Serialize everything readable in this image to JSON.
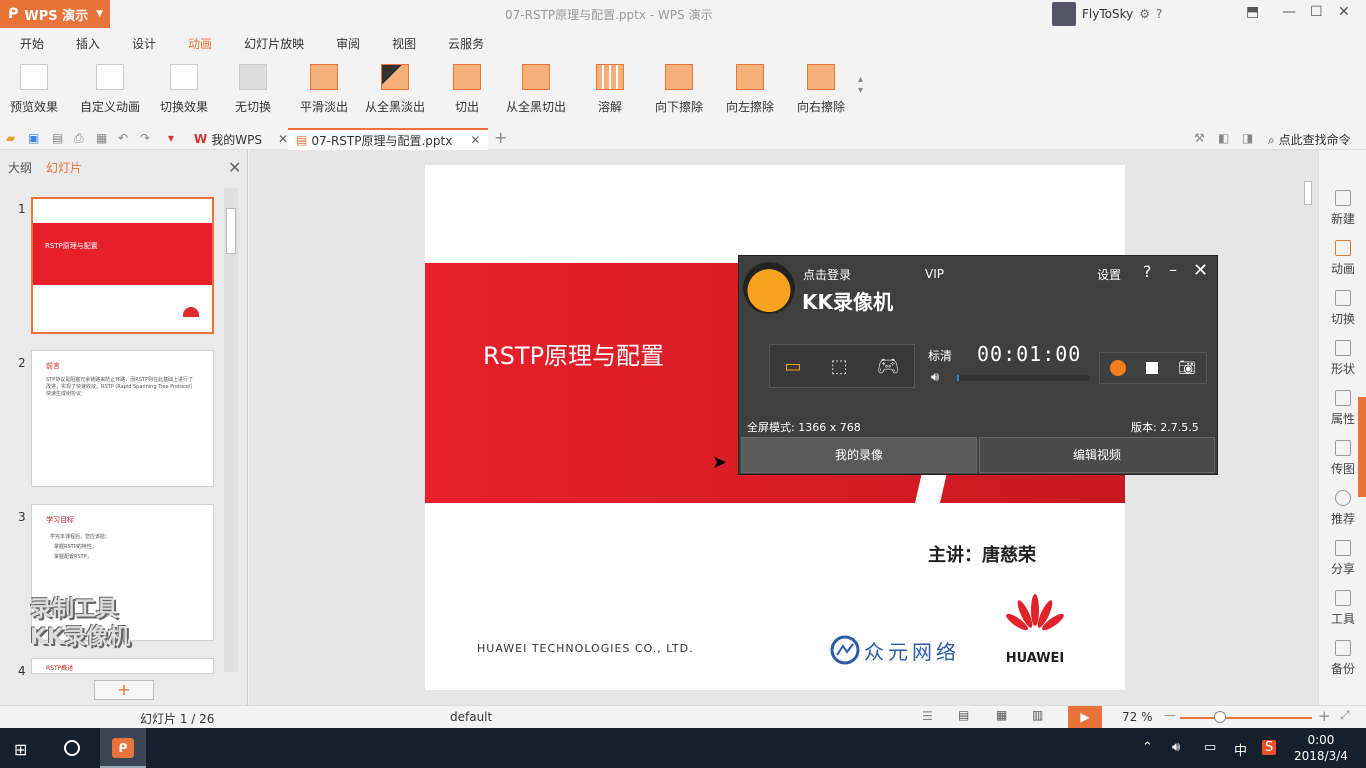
{
  "app": {
    "menu_label": "WPS 演示",
    "doc_title": "07-RSTP原理与配置.pptx - WPS 演示",
    "username": "FlyToSky"
  },
  "menu": {
    "tabs": [
      "开始",
      "插入",
      "设计",
      "动画",
      "幻灯片放映",
      "审阅",
      "视图",
      "云服务"
    ],
    "active": "动画"
  },
  "ribbon": {
    "items": [
      "预览效果",
      "自定义动画",
      "切换效果",
      "无切换",
      "平滑淡出",
      "从全黑淡出",
      "切出",
      "从全黑切出",
      "溶解",
      "向下擦除",
      "向左擦除",
      "向右擦除"
    ]
  },
  "doctabs": {
    "home": "我的WPS",
    "current": "07-RSTP原理与配置.pptx",
    "find": "点此查找命令"
  },
  "panel": {
    "tab_outline": "大纲",
    "tab_slides": "幻灯片",
    "numbers": [
      "1",
      "2",
      "3",
      "4"
    ],
    "thumb1_title": "RSTP原理与配置",
    "thumb2_title": "前言",
    "thumb2_body": "STP协议是阻塞冗余链路来防止环路，而RSTP则在此基础上进行了改进，实现了快速收敛。RSTP (Rapid Spanning Tree Protocol) 快速生成树协议",
    "thumb3_title": "学习目标",
    "thumb3_body1": "学完本课程后，您应该能：",
    "thumb3_body2": "掌握RSTP的特性；",
    "thumb3_body3": "掌握配置RSTP；",
    "thumb4_title": "RSTP概述"
  },
  "slide": {
    "title": "RSTP原理与配置",
    "presenter": "主讲：唐慈荣",
    "company": "HUAWEI TECHNOLOGIES CO., LTD.",
    "partner": "众元网络",
    "brand": "HUAWEI"
  },
  "sidebar": {
    "items": [
      "新建",
      "动画",
      "切换",
      "形状",
      "属性",
      "传图",
      "推荐",
      "分享",
      "工具",
      "备份"
    ]
  },
  "status": {
    "slide_counter": "幻灯片 1 / 26",
    "theme": "default",
    "zoom": "72 %",
    "zoom_fraction": 0.3
  },
  "taskbar": {
    "time": "0:00",
    "date": "2018/3/4",
    "ime": "中"
  },
  "recorder": {
    "login": "点击登录",
    "vip": "VIP",
    "name": "KK录像机",
    "settings": "设置",
    "quality": "标清",
    "timer": "00:01:00",
    "mode_label": "全屏模式: 1366 x 768",
    "version": "版本: 2.7.5.5",
    "my_recordings": "我的录像",
    "edit_video": "编辑视频"
  },
  "watermark": {
    "line1": "录制工具",
    "line2": "KK录像机"
  },
  "colors": {
    "accent": "#e8743b",
    "slide_red": "#e8202b",
    "recorder_bg": "#3f3f3f"
  }
}
